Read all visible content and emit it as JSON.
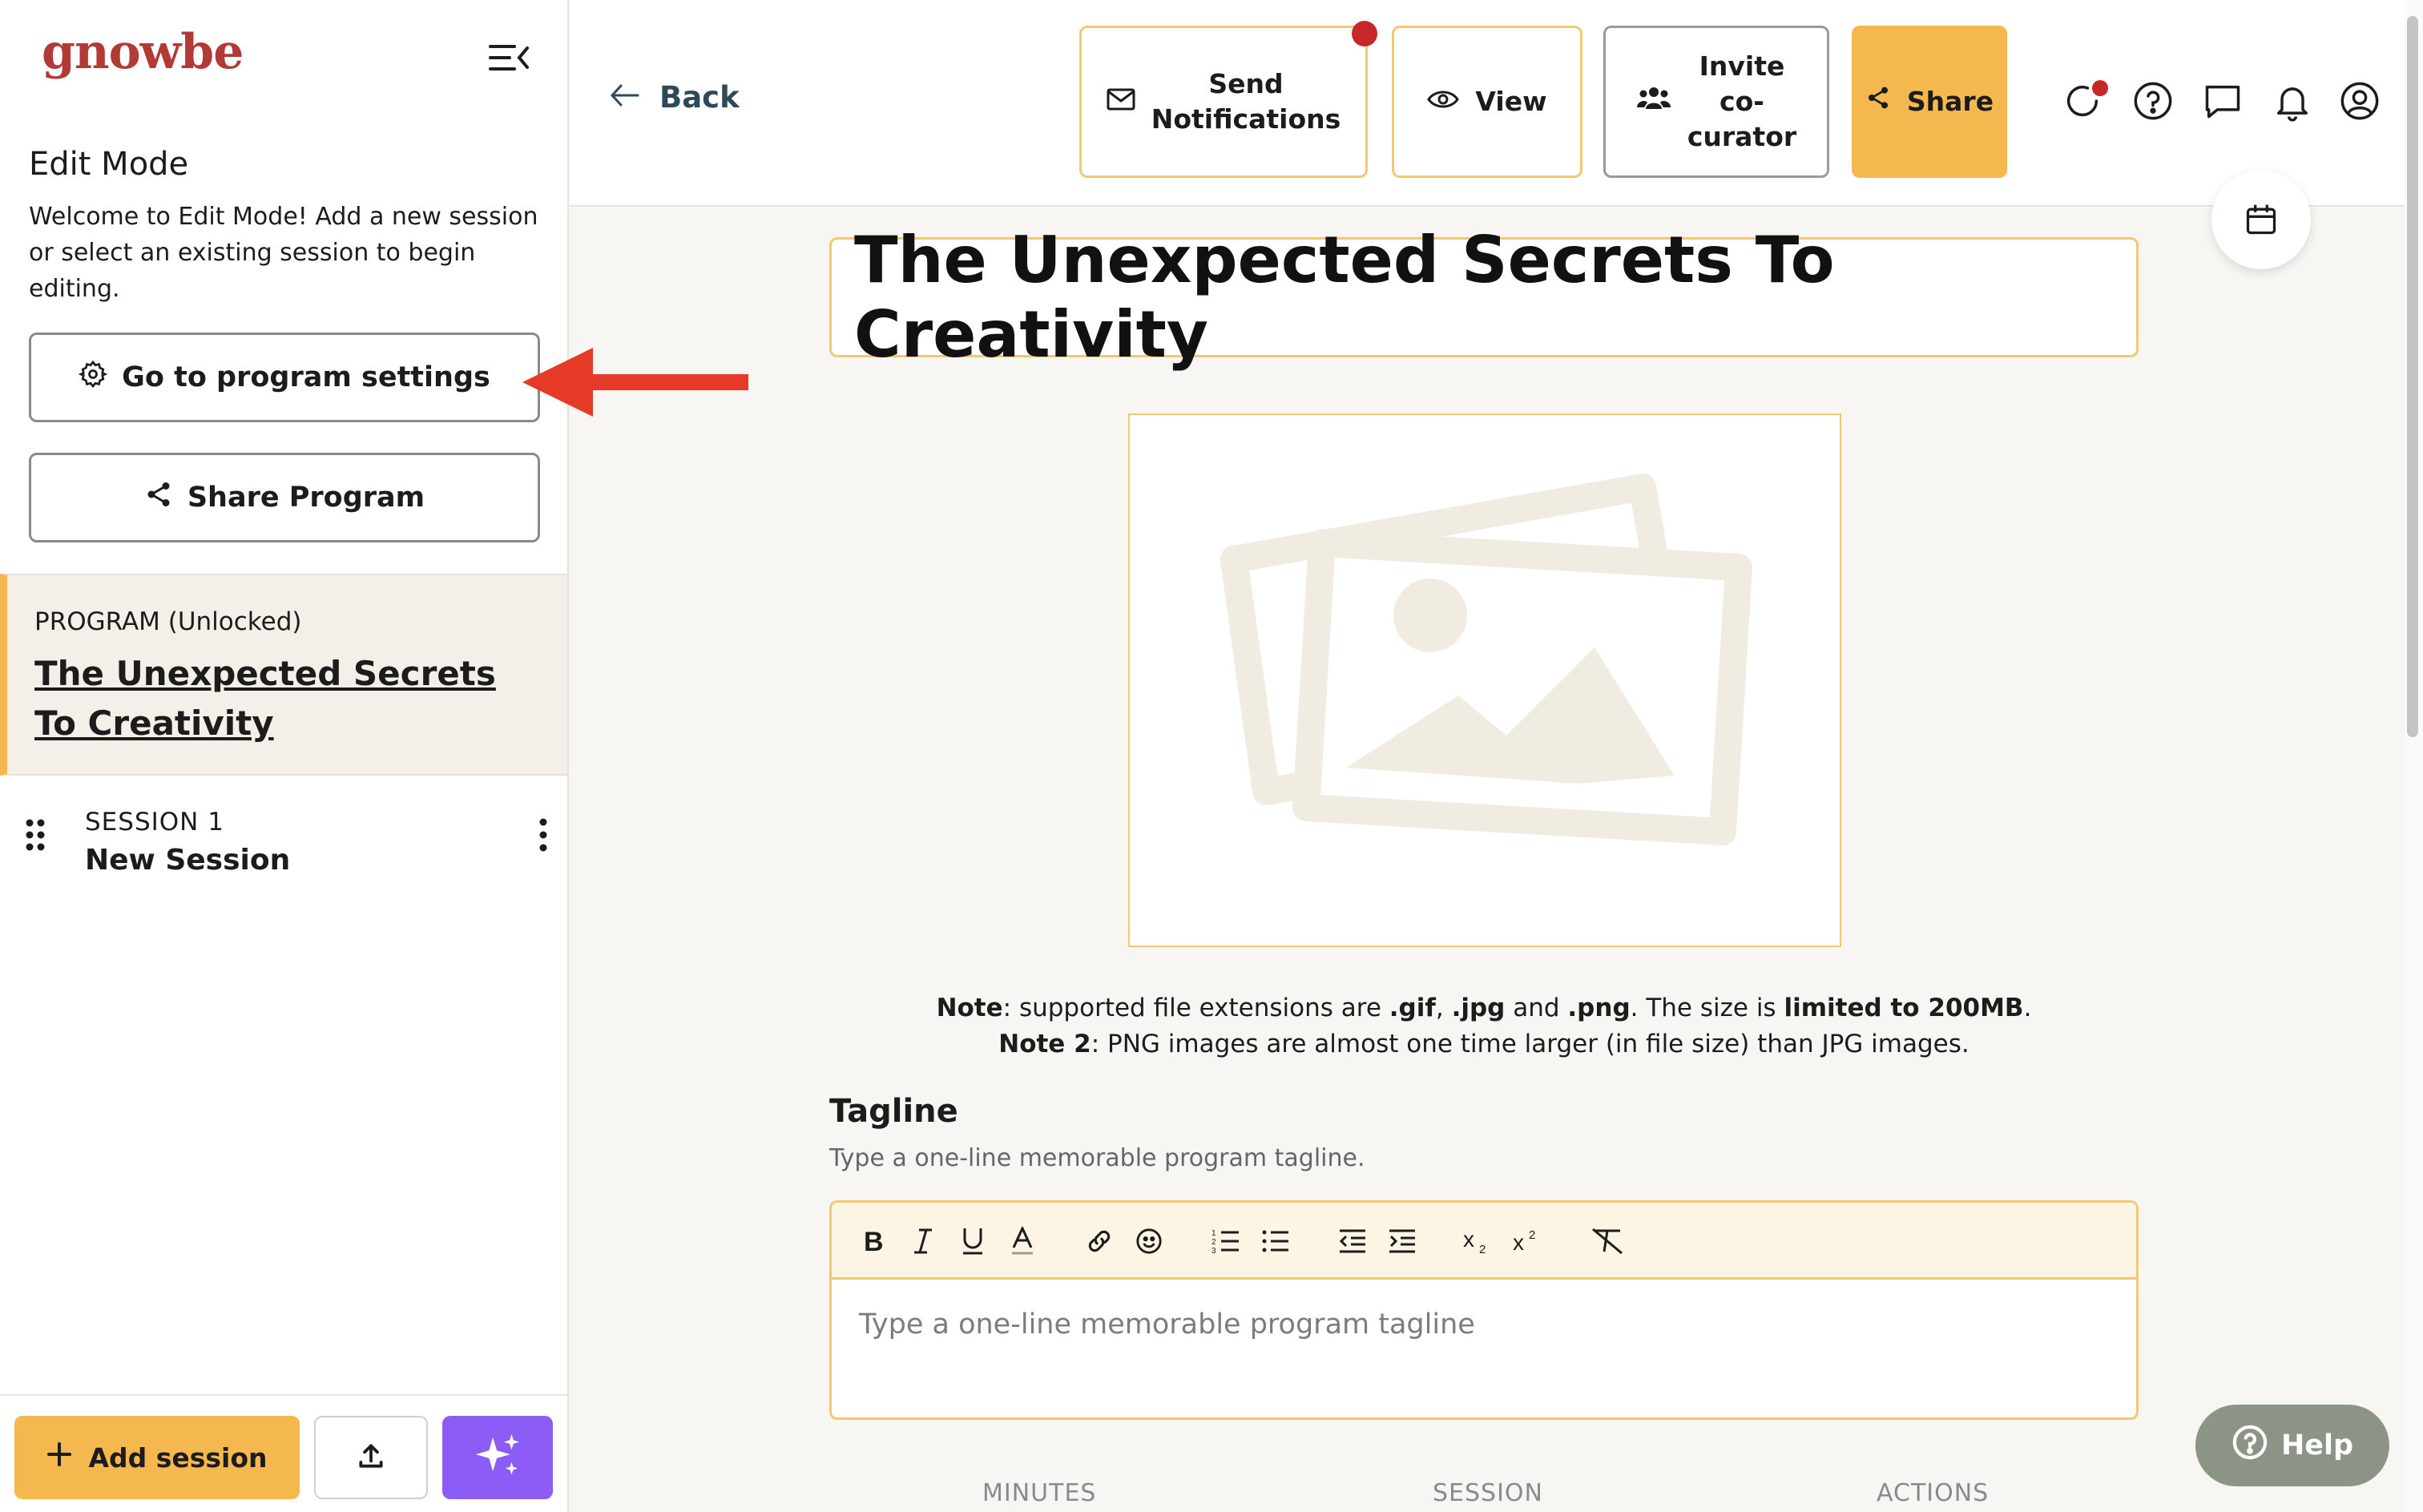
{
  "app": {
    "logo": "gnowbe"
  },
  "sidebar": {
    "edit_title": "Edit Mode",
    "edit_desc": "Welcome to Edit Mode! Add a new session or select an existing session to begin editing.",
    "settings_btn": "Go to program settings",
    "share_btn": "Share Program",
    "program_tag": "PROGRAM (Unlocked)",
    "program_name": "The Unexpected Secrets To Creativity",
    "sessions": [
      {
        "number": "SESSION 1",
        "name": "New Session"
      }
    ],
    "add_session": "Add session"
  },
  "topbar": {
    "back": "Back",
    "send_line1": "Send",
    "send_line2": "Notifications",
    "view": "View",
    "invite_line1": "Invite",
    "invite_line2": "co-",
    "invite_line3": "curator",
    "share": "Share"
  },
  "main": {
    "title": "The Unexpected Secrets To Creativity",
    "note1": {
      "label": "Note",
      "text1": ": supported file extensions are ",
      "ext1": ".gif",
      "sep1": ", ",
      "ext2": ".jpg",
      "sep2": " and ",
      "ext3": ".png",
      "text2": ". The size is ",
      "limit": "limited to 200MB",
      "end": "."
    },
    "note2": {
      "label": "Note 2",
      "text": ": PNG images are almost one time larger (in file size) than JPG images."
    },
    "tagline_label": "Tagline",
    "tagline_help": "Type a one-line memorable program tagline.",
    "tagline_placeholder": "Type a one-line memorable program tagline",
    "table_headers": [
      "MINUTES",
      "SESSION",
      "ACTIONS"
    ]
  },
  "help": {
    "label": "Help"
  },
  "colors": {
    "accent": "#f4b84e",
    "brand": "#b23a36",
    "alert": "#c62828",
    "ai": "#8b5cf6",
    "arrow": "#e53a25"
  },
  "icons": [
    "menu-collapse-icon",
    "gear-icon",
    "share-icon",
    "drag-handle-icon",
    "kebab-icon",
    "plus-icon",
    "upload-icon",
    "sparkles-icon",
    "arrow-left-icon",
    "mail-icon",
    "eye-icon",
    "users-icon",
    "refresh-icon",
    "help-circle-icon",
    "chat-icon",
    "bell-icon",
    "user-icon",
    "calendar-icon",
    "image-placeholder-icon"
  ]
}
